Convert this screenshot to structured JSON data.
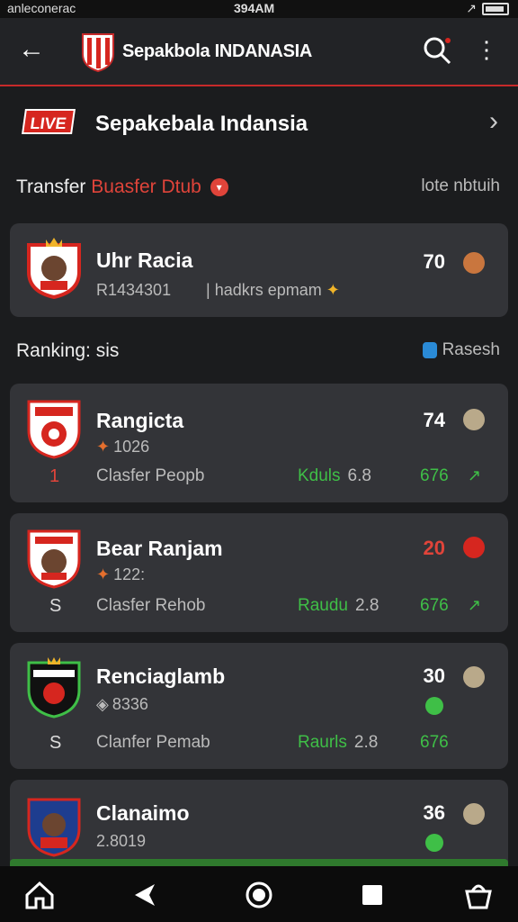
{
  "status_bar": {
    "carrier": "anleconerac",
    "time": "394AM"
  },
  "app_bar": {
    "title": "Sepakbola INDANASIA"
  },
  "live": {
    "badge": "LIVE",
    "title": "Sepakebala Indansia"
  },
  "transfer_section": {
    "label": "Transfer",
    "accent": "Buasfer Dtub",
    "right_label": "lote nbtuih"
  },
  "featured": {
    "name": "Uhr Racia",
    "code": "R1434301",
    "note": "hadkrs epmam",
    "score": "70"
  },
  "ranking_section": {
    "label": "Ranking: sis",
    "right_label": "Rasesh"
  },
  "ranking": [
    {
      "name": "Rangicta",
      "sub": "1026",
      "rank": "1",
      "club": "Clasfer Peopb",
      "result": "Kduls",
      "result_num": "6.8",
      "pts": "676",
      "score": "74"
    },
    {
      "name": "Bear Ranjam",
      "sub": "122:",
      "rank": "S",
      "club": "Clasfer Rehob",
      "result": "Raudu",
      "result_num": "2.8",
      "pts": "676",
      "score": "20"
    },
    {
      "name": "Renciaglamb",
      "sub": "8336",
      "rank": "S",
      "club": "Clanfer Pemab",
      "result": "Raurls",
      "result_num": "2.8",
      "pts": "676",
      "score": "30"
    },
    {
      "name": "Clanaimo",
      "sub": "2.8019",
      "score": "36"
    }
  ],
  "colors": {
    "accent_red": "#d6261f",
    "accent_green": "#3fbf47",
    "card_bg": "#333438"
  },
  "icons": [
    "back-arrow-icon",
    "search-icon",
    "more-icon",
    "chevron-right-icon",
    "home-icon",
    "back-triangle-icon",
    "circle-home-icon",
    "square-recent-icon",
    "basket-icon"
  ]
}
